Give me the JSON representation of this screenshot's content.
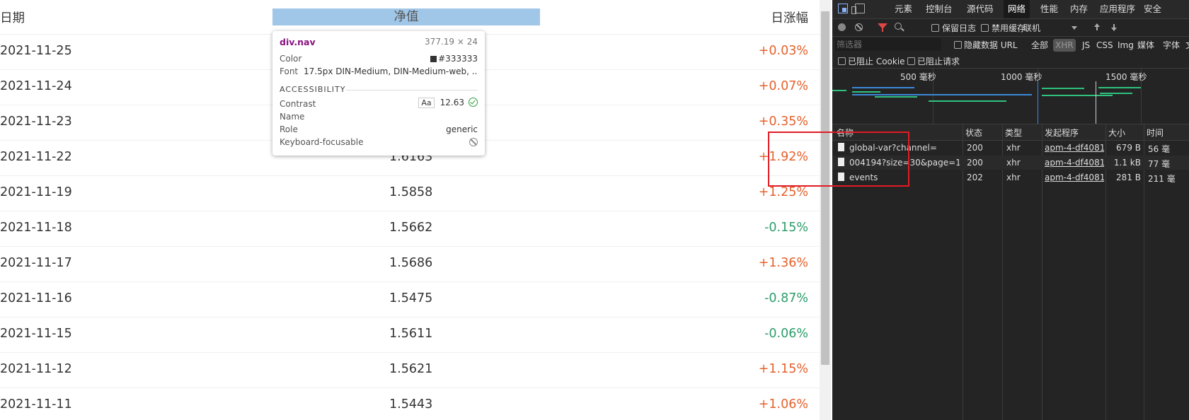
{
  "table": {
    "headers": {
      "date": "日期",
      "nav": "净值",
      "change": "日涨幅"
    },
    "rows": [
      {
        "date": "2021-11-25",
        "nav": "",
        "change": "+0.03%",
        "dir": "up"
      },
      {
        "date": "2021-11-24",
        "nav": "",
        "change": "+0.07%",
        "dir": "up"
      },
      {
        "date": "2021-11-23",
        "nav": "",
        "change": "+0.35%",
        "dir": "up"
      },
      {
        "date": "2021-11-22",
        "nav": "1.6163",
        "change": "+1.92%",
        "dir": "up"
      },
      {
        "date": "2021-11-19",
        "nav": "1.5858",
        "change": "+1.25%",
        "dir": "up"
      },
      {
        "date": "2021-11-18",
        "nav": "1.5662",
        "change": "-0.15%",
        "dir": "down"
      },
      {
        "date": "2021-11-17",
        "nav": "1.5686",
        "change": "+1.36%",
        "dir": "up"
      },
      {
        "date": "2021-11-16",
        "nav": "1.5475",
        "change": "-0.87%",
        "dir": "down"
      },
      {
        "date": "2021-11-15",
        "nav": "1.5611",
        "change": "-0.06%",
        "dir": "down"
      },
      {
        "date": "2021-11-12",
        "nav": "1.5621",
        "change": "+1.15%",
        "dir": "up"
      },
      {
        "date": "2021-11-11",
        "nav": "1.5443",
        "change": "+1.06%",
        "dir": "up"
      }
    ]
  },
  "tooltip": {
    "selector": "div.nav",
    "dims": "377.19 × 24",
    "color_label": "Color",
    "color_value": "#333333",
    "font_label": "Font",
    "font_value": "17.5px DIN-Medium, DIN-Medium-web, ...",
    "section": "ACCESSIBILITY",
    "contrast_label": "Contrast",
    "contrast_aa": "Aa",
    "contrast_value": "12.63",
    "name_label": "Name",
    "role_label": "Role",
    "role_value": "generic",
    "kbd_label": "Keyboard-focusable"
  },
  "devtools": {
    "tabs": [
      "元素",
      "控制台",
      "源代码",
      "网络",
      "性能",
      "内存",
      "应用程序",
      "安全"
    ],
    "active_tab": "网络",
    "toolbar": {
      "preserve_log": "保留日志",
      "disable_cache": "禁用缓存",
      "throttle": "联机"
    },
    "filter": {
      "placeholder": "筛选器",
      "hide_data_urls": "隐藏数据 URL",
      "types": [
        "全部",
        "XHR",
        "JS",
        "CSS",
        "Img",
        "媒体",
        "字体",
        "文"
      ],
      "active_type": "XHR",
      "blocked_cookies": "已阻止 Cookie",
      "blocked_requests": "已阻止请求"
    },
    "timeline_ticks": [
      "500 毫秒",
      "1000 毫秒",
      "1500 毫秒"
    ],
    "columns": {
      "name": "名称",
      "status": "状态",
      "type": "类型",
      "initiator": "发起程序",
      "size": "大小",
      "time": "时间"
    },
    "requests": [
      {
        "name": "global-var?channel=",
        "status": "200",
        "type": "xhr",
        "initiator": "apm-4-df4081...",
        "size": "679 B",
        "time": "56 毫"
      },
      {
        "name": "004194?size=30&page=1",
        "status": "200",
        "type": "xhr",
        "initiator": "apm-4-df4081...",
        "size": "1.1 kB",
        "time": "77 毫"
      },
      {
        "name": "events",
        "status": "202",
        "type": "xhr",
        "initiator": "apm-4-df4081...",
        "size": "281 B",
        "time": "211 毫"
      }
    ]
  },
  "colors": {
    "up": "#e5612c",
    "down": "#2c9c6a",
    "highlight": "#e01b24"
  }
}
